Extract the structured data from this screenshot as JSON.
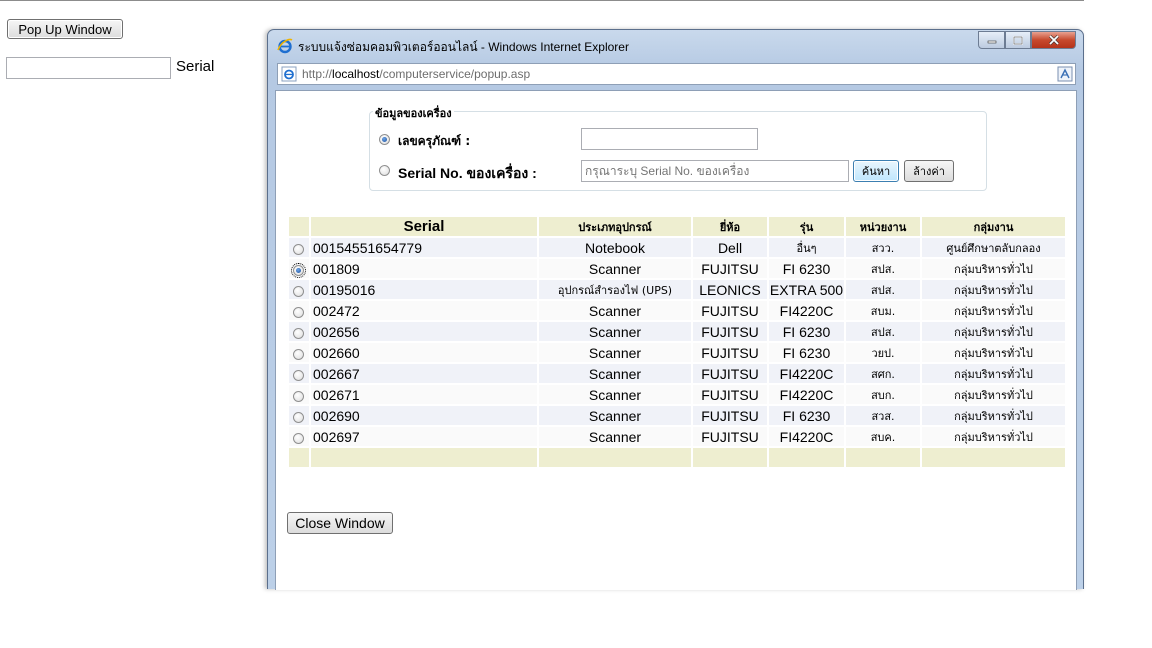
{
  "main": {
    "popup_button_label": "Pop Up Window",
    "serial_label": "Serial",
    "serial_value": ""
  },
  "ie": {
    "title": "ระบบแจ้งซ่อมคอมพิวเตอร์ออนไลน์ - Windows Internet Explorer",
    "url_prefix": "http://",
    "url_host": "localhost",
    "url_path": "/computerservice/popup.asp"
  },
  "form": {
    "legend": "ข้อมูลของเครื่อง",
    "asset_label": "เลขครุภัณฑ์ :",
    "serial_label": "Serial No. ของเครื่อง :",
    "asset_value": "",
    "serial_placeholder": "กรุณาระบุ Serial No. ของเครื่อง",
    "search_label": "ค้นหา",
    "clear_label": "ล้างค่า",
    "selected_mode": "asset"
  },
  "table": {
    "headers": [
      "Serial",
      "ประเภทอุปกรณ์",
      "ยี่ห้อ",
      "รุ่น",
      "หน่วยงาน",
      "กลุ่มงาน"
    ],
    "selected_index": 1,
    "rows": [
      {
        "serial": "00154551654779",
        "type": "Notebook",
        "brand": "Dell",
        "model": "อื่นๆ",
        "unit": "สวว.",
        "group": "ศูนย์ศึกษาตลับกลอง"
      },
      {
        "serial": "001809",
        "type": "Scanner",
        "brand": "FUJITSU",
        "model": "FI 6230",
        "unit": "สปส.",
        "group": "กลุ่มบริหารทั่วไป"
      },
      {
        "serial": "00195016",
        "type": "อุปกรณ์สำรองไฟ (UPS)",
        "brand": "LEONICS",
        "model": "EXTRA 500",
        "unit": "สปส.",
        "group": "กลุ่มบริหารทั่วไป"
      },
      {
        "serial": "002472",
        "type": "Scanner",
        "brand": "FUJITSU",
        "model": "FI4220C",
        "unit": "สบม.",
        "group": "กลุ่มบริหารทั่วไป"
      },
      {
        "serial": "002656",
        "type": "Scanner",
        "brand": "FUJITSU",
        "model": "FI 6230",
        "unit": "สปส.",
        "group": "กลุ่มบริหารทั่วไป"
      },
      {
        "serial": "002660",
        "type": "Scanner",
        "brand": "FUJITSU",
        "model": "FI 6230",
        "unit": "วยป.",
        "group": "กลุ่มบริหารทั่วไป"
      },
      {
        "serial": "002667",
        "type": "Scanner",
        "brand": "FUJITSU",
        "model": "FI4220C",
        "unit": "สศก.",
        "group": "กลุ่มบริหารทั่วไป"
      },
      {
        "serial": "002671",
        "type": "Scanner",
        "brand": "FUJITSU",
        "model": "FI4220C",
        "unit": "สบก.",
        "group": "กลุ่มบริหารทั่วไป"
      },
      {
        "serial": "002690",
        "type": "Scanner",
        "brand": "FUJITSU",
        "model": "FI 6230",
        "unit": "สวส.",
        "group": "กลุ่มบริหารทั่วไป"
      },
      {
        "serial": "002697",
        "type": "Scanner",
        "brand": "FUJITSU",
        "model": "FI4220C",
        "unit": "สบค.",
        "group": "กลุ่มบริหารทั่วไป"
      }
    ]
  },
  "close_window_label": "Close Window"
}
